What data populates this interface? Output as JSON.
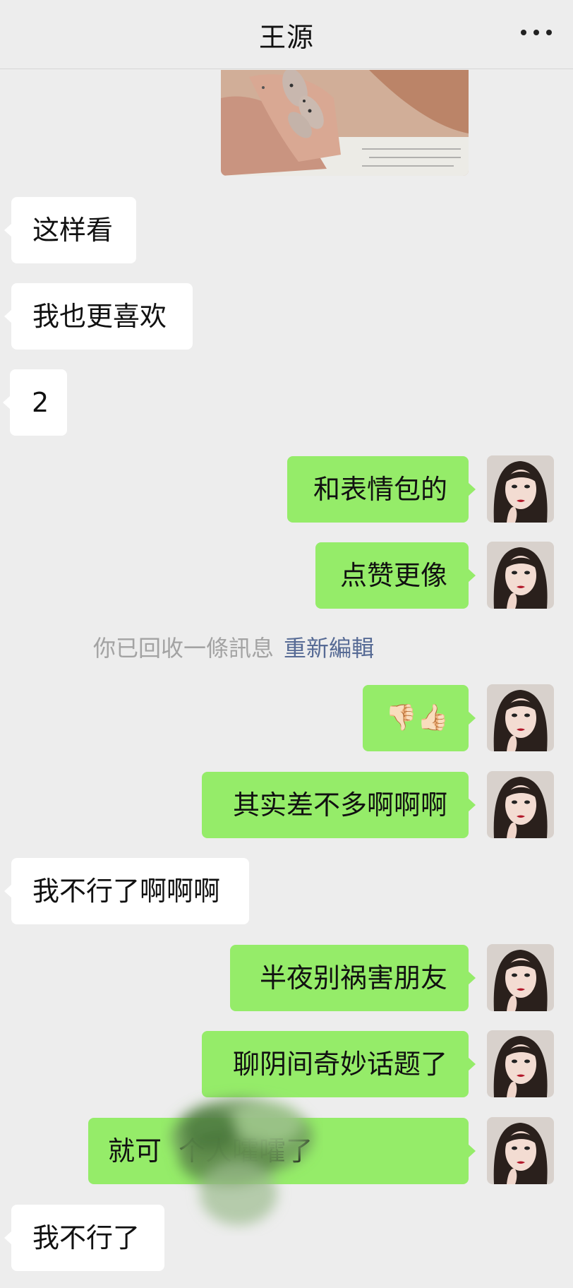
{
  "header": {
    "title": "王源",
    "more_icon": "more-dots-icon"
  },
  "messages": [
    {
      "side": "in",
      "text": "这样看"
    },
    {
      "side": "in",
      "text": "我也更喜欢"
    },
    {
      "side": "in",
      "text": "2"
    },
    {
      "side": "out",
      "text": "和表情包的"
    },
    {
      "side": "out",
      "text": "点赞更像"
    },
    {
      "side": "out",
      "text": "👎🏻👍🏻"
    },
    {
      "side": "out",
      "text": "其实差不多啊啊啊"
    },
    {
      "side": "in",
      "text": "我不行了啊啊啊"
    },
    {
      "side": "out",
      "text": "半夜别祸害朋友"
    },
    {
      "side": "out",
      "text": "聊阴间奇妙话题了"
    },
    {
      "side": "out",
      "text": "就可  个人嚯嚯了"
    },
    {
      "side": "in",
      "text": "我不行了"
    }
  ],
  "recall": {
    "text": "你已回收一條訊息",
    "reedit": "重新編輯"
  },
  "colors": {
    "background": "#ededed",
    "incoming_bubble": "#ffffff",
    "outgoing_bubble": "#95ec69",
    "link": "#576b95"
  }
}
